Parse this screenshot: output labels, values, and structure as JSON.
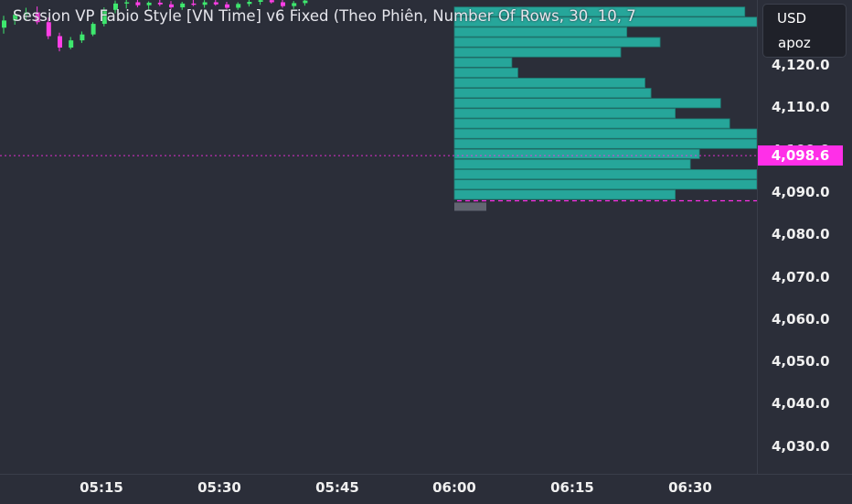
{
  "indicator": {
    "title": "Session VP Fabio Style [VN Time] v6 Fixed (Theo Phiên, Number Of Rows, 30, 10, 7"
  },
  "currency": {
    "code": "USD",
    "account": "apoz"
  },
  "last_price": {
    "label": "4,098.6",
    "value": 4098.6,
    "color": "#ff2fe8"
  },
  "colors": {
    "background": "#2b2e39",
    "profile_bar": "#26a69a",
    "candle_up": "#3ee86e",
    "candle_down": "#ff3fe6",
    "poc_line": "#ff2fe8",
    "value_area_box": "#6b6f7a"
  },
  "chart_data": {
    "type": "bar",
    "title": "Session VP Fabio Style [VN Time] v6 Fixed (Theo Phiên, Number Of Rows, 30, 10, 7",
    "y_axis": {
      "ticks": [
        "4,120.0",
        "4,110.0",
        "4,100.0",
        "4,090.0",
        "4,080.0",
        "4,070.0",
        "4,060.0",
        "4,050.0",
        "4,040.0",
        "4,030.0"
      ],
      "range": [
        4025,
        4135
      ]
    },
    "x_axis": {
      "ticks": [
        "05:15",
        "05:30",
        "05:45",
        "06:00",
        "06:15",
        "06:30"
      ]
    },
    "volume_profile": {
      "orientation": "horizontal",
      "start_time": "06:00",
      "price_levels": [
        4132.6,
        4130.2,
        4127.8,
        4125.4,
        4123.0,
        4120.6,
        4118.2,
        4115.8,
        4113.4,
        4111.0,
        4108.6,
        4106.2,
        4103.8,
        4101.4,
        4099.0,
        4096.6,
        4094.2,
        4091.8,
        4089.4
      ],
      "relative_volume": [
        0.96,
        1.0,
        0.57,
        0.68,
        0.55,
        0.19,
        0.21,
        0.63,
        0.65,
        0.88,
        0.73,
        0.91,
        1.0,
        1.0,
        0.81,
        0.78,
        1.0,
        1.0,
        0.73
      ]
    },
    "candles": {
      "note": "partially visible price bars behind title",
      "ohlc": [
        [
          4128.8,
          4131.6,
          4127.4,
          4130.5
        ],
        [
          4130.5,
          4132.8,
          4129.5,
          4131.9
        ],
        [
          4131.9,
          4133.5,
          4130.7,
          4132.4
        ],
        [
          4132.4,
          4133.8,
          4129.6,
          4130.1
        ],
        [
          4130.1,
          4131.2,
          4126.1,
          4126.8
        ],
        [
          4126.8,
          4127.6,
          4123.2,
          4124.1
        ],
        [
          4124.1,
          4126.6,
          4123.7,
          4125.8
        ],
        [
          4125.8,
          4127.9,
          4125.2,
          4127.2
        ],
        [
          4127.2,
          4130.1,
          4126.8,
          4129.7
        ],
        [
          4129.7,
          4133.6,
          4129.1,
          4133.0
        ],
        [
          4133.0,
          4135.2,
          4132.2,
          4134.5
        ],
        [
          4134.5,
          4135.8,
          4133.3,
          4134.8
        ],
        [
          4134.8,
          4135.5,
          4133.6,
          4134.1
        ],
        [
          4134.1,
          4135.0,
          4132.8,
          4134.7
        ],
        [
          4134.7,
          4135.8,
          4133.9,
          4134.3
        ],
        [
          4134.3,
          4135.1,
          4133.1,
          4133.6
        ],
        [
          4133.6,
          4134.9,
          4133.0,
          4134.5
        ],
        [
          4134.5,
          4135.4,
          4133.9,
          4134.2
        ],
        [
          4134.2,
          4135.3,
          4133.5,
          4134.8
        ],
        [
          4134.8,
          4135.7,
          4134.0,
          4134.3
        ],
        [
          4134.3,
          4134.9,
          4133.2,
          4133.5
        ],
        [
          4133.5,
          4134.8,
          4133.0,
          4134.4
        ],
        [
          4134.4,
          4135.6,
          4133.8,
          4134.9
        ],
        [
          4134.9,
          4135.9,
          4134.2,
          4135.3
        ],
        [
          4135.3,
          4135.9,
          4134.5,
          4134.8
        ],
        [
          4134.8,
          4135.4,
          4133.5,
          4133.9
        ],
        [
          4133.9,
          4135.1,
          4133.2,
          4134.6
        ],
        [
          4134.6,
          4135.8,
          4134.0,
          4135.2
        ]
      ]
    },
    "value_area_low": 4087.5
  }
}
